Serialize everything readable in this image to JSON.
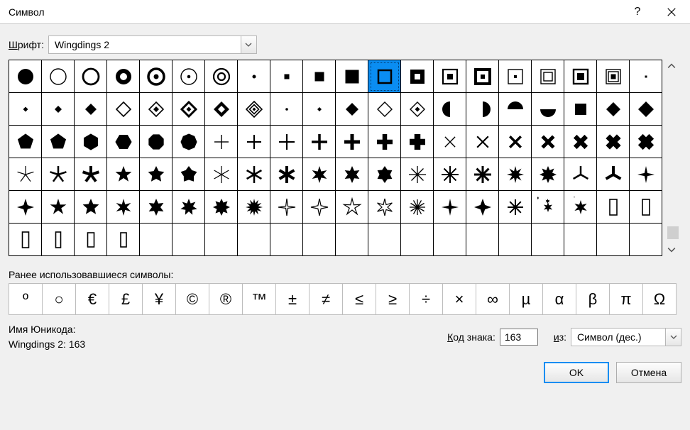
{
  "title": "Символ",
  "font_label": "Шрифт:",
  "font_value": "Wingdings 2",
  "recent_label": "Ранее использовавшиеся символы:",
  "recent": [
    "º",
    "○",
    "€",
    "£",
    "¥",
    "©",
    "®",
    "™",
    "±",
    "≠",
    "≤",
    "≥",
    "÷",
    "×",
    "∞",
    "µ",
    "α",
    "β",
    "π",
    "Ω"
  ],
  "unicode_name_label": "Имя Юникода:",
  "unicode_name_value": "Wingdings 2: 163",
  "code_label": "Код знака:",
  "code_value": "163",
  "from_label": "из:",
  "from_value": "Символ (дес.)",
  "ok_label": "OK",
  "cancel_label": "Отмена",
  "grid": {
    "rows": 6,
    "cols": 20,
    "selected": 11
  }
}
